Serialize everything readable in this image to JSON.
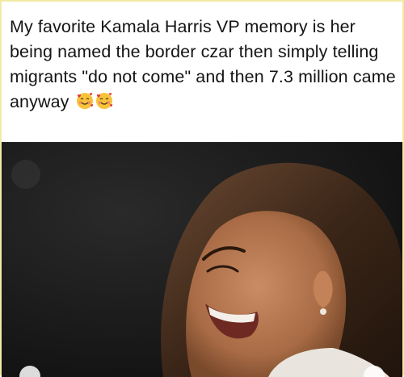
{
  "post": {
    "text": "My favorite Kamala Harris VP memory is her being named the border czar then simply telling migrants \"do not come\" and then 7.3 million came anyway",
    "emojis": [
      "smiling-face-with-hearts-icon",
      "smiling-face-with-hearts-icon"
    ]
  },
  "colors": {
    "frame_border": "#f2e9a6",
    "text": "#141414",
    "photo_bg": "#1b1b1b"
  }
}
